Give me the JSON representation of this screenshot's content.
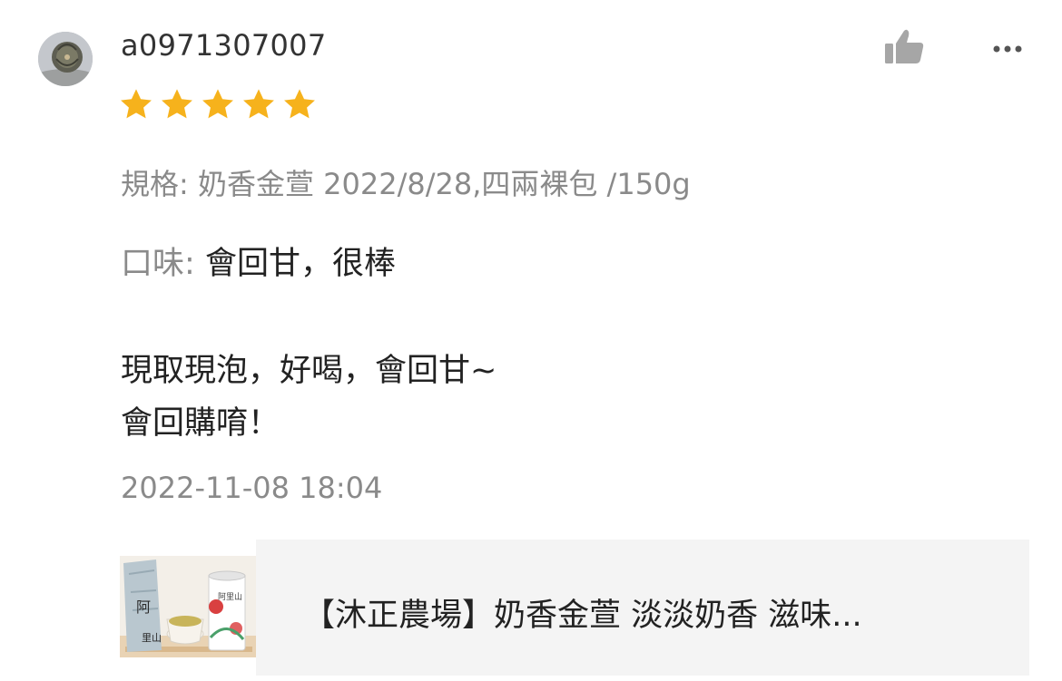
{
  "review": {
    "username": "a0971307007",
    "rating": 5,
    "rating_max": 5,
    "variation": "規格: 奶香金萱 2022/8/28,四兩裸包 /150g",
    "taste_label": "口味:",
    "taste_value": "會回甘，很棒",
    "comment_lines": [
      "現取現泡，好喝，會回甘~",
      "會回購唷！"
    ],
    "timestamp": "2022-11-08 18:04"
  },
  "actions": {
    "like_icon": "thumbs-up-icon",
    "more_icon": "more-dots-icon"
  },
  "product": {
    "name": "【沐正農場】奶香金萱 淡淡奶香 滋味..."
  },
  "colors": {
    "star": "#f6b21c",
    "secondary_text": "#8a8a8a",
    "primary_text": "#222222",
    "icon_gray": "#a6a6a6",
    "card_bg": "#f4f4f4"
  }
}
